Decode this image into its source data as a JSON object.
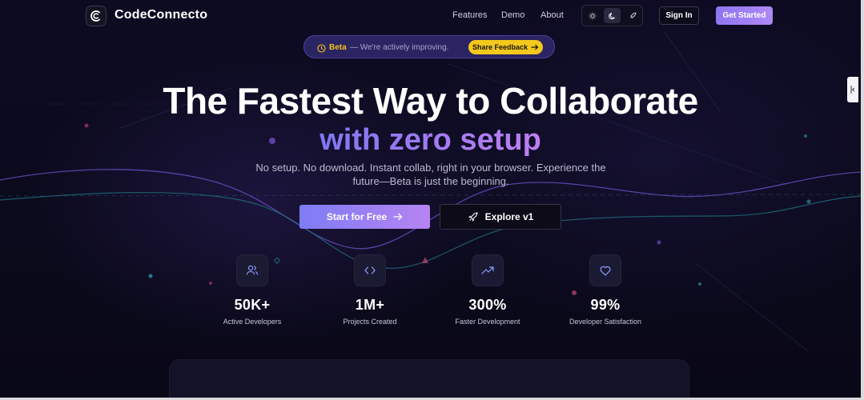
{
  "nav": {
    "logo_text": "CodeConnecto",
    "links": [
      "Features",
      "Demo",
      "About"
    ],
    "sign_in": "Sign In",
    "get_started": "Get Started"
  },
  "banner": {
    "label": "Beta",
    "text": "— We're actively improving.",
    "button": "Share Feedback"
  },
  "hero": {
    "title": "The Fastest Way to Collaborate",
    "subtitle": "with zero setup",
    "description": "No setup. No download. Instant collab, right in your browser. Experience the future—Beta is just the beginning.",
    "primary_cta": "Start for Free",
    "secondary_cta": "Explore v1"
  },
  "stats": [
    {
      "icon": "users-icon",
      "value": "50K+",
      "label": "Active Developers"
    },
    {
      "icon": "code-icon",
      "value": "1M+",
      "label": "Projects Created"
    },
    {
      "icon": "trending-up-icon",
      "value": "300%",
      "label": "Faster Development"
    },
    {
      "icon": "heart-icon",
      "value": "99%",
      "label": "Developer Satisfaction"
    }
  ],
  "colors": {
    "accent_start": "#7e7cf4",
    "accent_end": "#b684f2",
    "banner_yellow": "#f4c81c",
    "background": "#0b0a1c"
  }
}
